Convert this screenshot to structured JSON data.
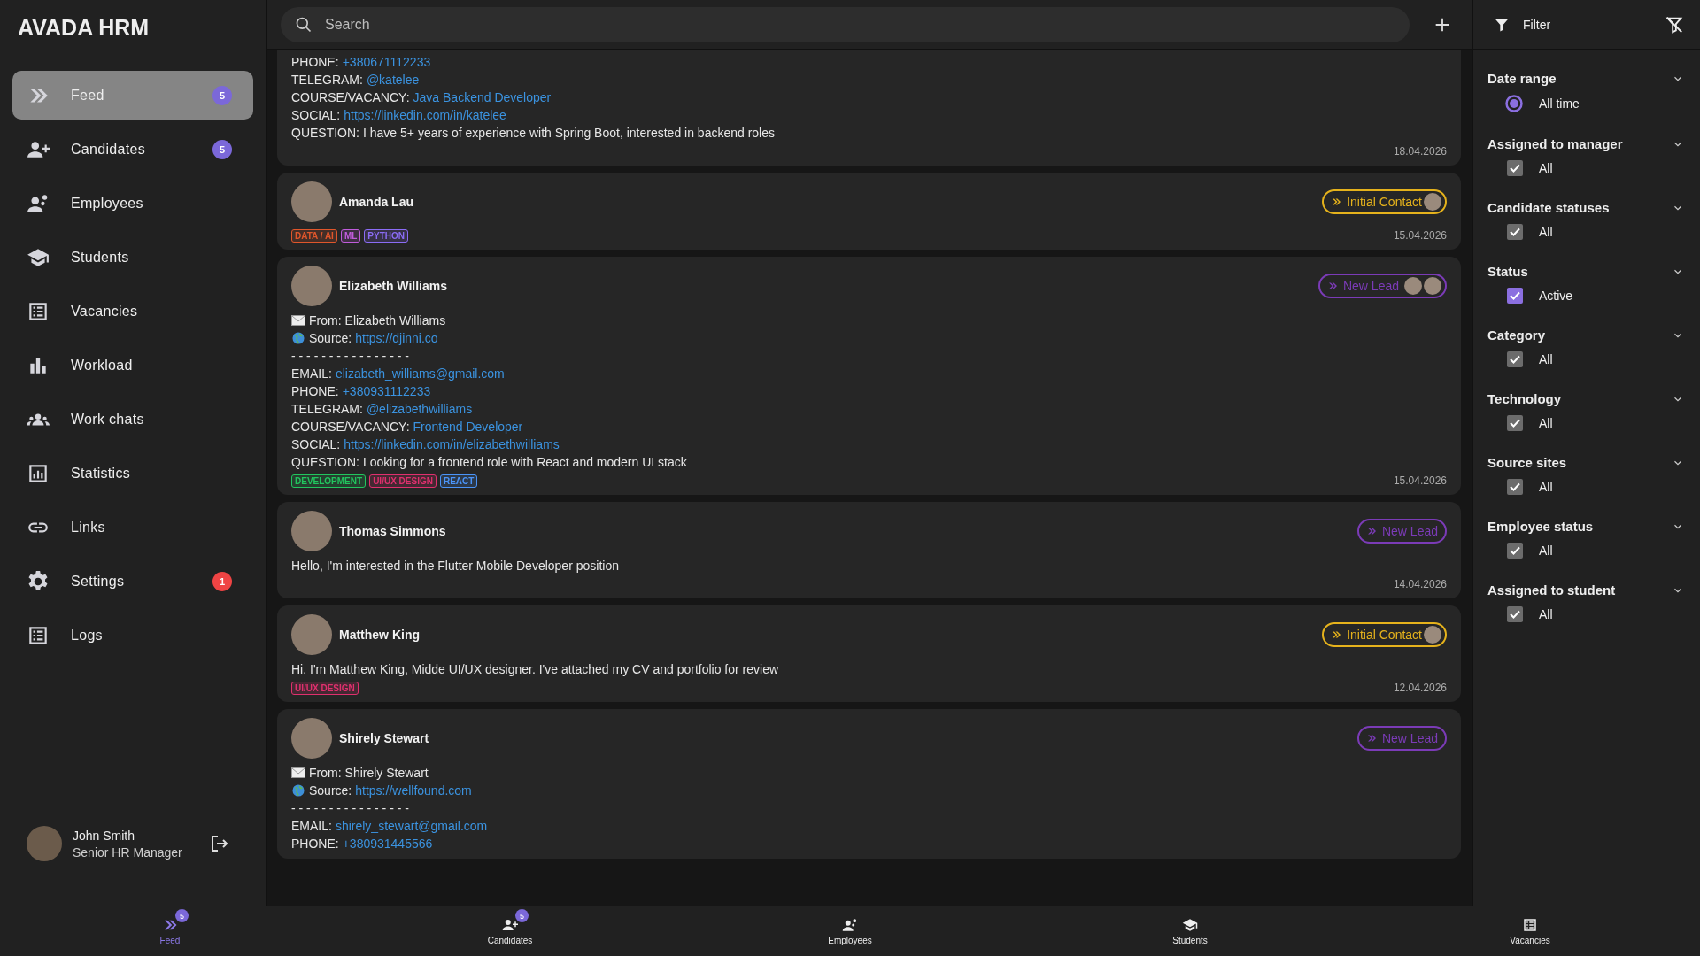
{
  "app": {
    "title": "AVADA HRM"
  },
  "sidebar": {
    "items": [
      {
        "label": "Feed",
        "badge": "5",
        "color": "#7b68d9",
        "selected": true
      },
      {
        "label": "Candidates",
        "badge": "5",
        "color": "#7b68d9",
        "selected": false
      },
      {
        "label": "Employees",
        "selected": false
      },
      {
        "label": "Students",
        "selected": false
      },
      {
        "label": "Vacancies",
        "selected": false
      },
      {
        "label": "Workload",
        "selected": false
      },
      {
        "label": "Work chats",
        "selected": false
      },
      {
        "label": "Statistics",
        "selected": false
      },
      {
        "label": "Links",
        "selected": false
      },
      {
        "label": "Settings",
        "badge": "1",
        "color": "#ef4444",
        "selected": false
      },
      {
        "label": "Logs",
        "selected": false
      }
    ],
    "user": {
      "name": "John Smith",
      "role": "Senior HR Manager"
    }
  },
  "search": {
    "placeholder": "Search"
  },
  "feed": [
    {
      "cut_top": true,
      "lines": [
        {
          "kind": "field",
          "label": "PHONE:",
          "value": "+380671112233",
          "link": true
        },
        {
          "kind": "field",
          "label": "TELEGRAM:",
          "value": "@katelee",
          "link": true
        },
        {
          "kind": "field",
          "label": "COURSE/VACANCY:",
          "value": "Java Backend Developer",
          "link": true
        },
        {
          "kind": "field",
          "label": "SOCIAL:",
          "value": "https://linkedin.com/in/katelee",
          "link": true
        },
        {
          "kind": "field",
          "label": "QUESTION:",
          "value": "I have 5+ years of experience with Spring Boot, interested in backend roles",
          "link": false
        }
      ],
      "date": "18.04.2026"
    },
    {
      "cut_top": false,
      "name": "Amanda Lau",
      "status": {
        "label": "Initial Contact",
        "kind": "initial",
        "assignees": [
          {
            "kind": "photo"
          }
        ]
      },
      "tags": [
        {
          "label": "DATA / AI",
          "color": "#e0562b"
        },
        {
          "label": "ML",
          "color": "#c05cdb"
        },
        {
          "label": "PYTHON",
          "color": "#8b6cf5"
        }
      ],
      "date": "15.04.2026"
    },
    {
      "cut_top": false,
      "name": "Elizabeth Williams",
      "status": {
        "label": "New Lead",
        "kind": "new",
        "assignees": [
          {
            "kind": "photo"
          },
          {
            "kind": "photo"
          }
        ]
      },
      "lines": [
        {
          "kind": "from",
          "label": "From:",
          "value": "Elizabeth Williams",
          "link": false
        },
        {
          "kind": "source",
          "label": "Source:",
          "value": "https://djinni.co",
          "link": true
        },
        {
          "kind": "separator",
          "value": "- - - - - - - - - - - - - - - -"
        },
        {
          "kind": "field",
          "label": "EMAIL:",
          "value": "elizabeth_williams@gmail.com",
          "link": true
        },
        {
          "kind": "field",
          "label": "PHONE:",
          "value": "+380931112233",
          "link": true
        },
        {
          "kind": "field",
          "label": "TELEGRAM:",
          "value": "@elizabethwilliams",
          "link": true
        },
        {
          "kind": "field",
          "label": "COURSE/VACANCY:",
          "value": "Frontend Developer",
          "link": true
        },
        {
          "kind": "field",
          "label": "SOCIAL:",
          "value": "https://linkedin.com/in/elizabethwilliams",
          "link": true
        },
        {
          "kind": "field",
          "label": "QUESTION:",
          "value": "Looking for a frontend role with React and modern UI stack",
          "link": false
        }
      ],
      "tags": [
        {
          "label": "DEVELOPMENT",
          "color": "#22c55e"
        },
        {
          "label": "UI/UX DESIGN",
          "color": "#e0306e"
        },
        {
          "label": "REACT",
          "color": "#4b94f8"
        }
      ],
      "date": "15.04.2026"
    },
    {
      "cut_top": false,
      "name": "Thomas Simmons",
      "status": {
        "label": "New Lead",
        "kind": "new"
      },
      "lines": [
        {
          "kind": "text",
          "value": "Hello, I'm interested in the Flutter Mobile Developer position"
        }
      ],
      "date": "14.04.2026"
    },
    {
      "cut_top": false,
      "name": "Matthew King",
      "status": {
        "label": "Initial Contact",
        "kind": "initial",
        "assignees": [
          {
            "kind": "photo"
          }
        ]
      },
      "lines": [
        {
          "kind": "text",
          "value": "Hi, I'm Matthew King, Midde UI/UX designer. I've attached my CV and portfolio for review"
        }
      ],
      "tags": [
        {
          "label": "UI/UX DESIGN",
          "color": "#e0306e"
        }
      ],
      "date": "12.04.2026"
    },
    {
      "cut_top": false,
      "name": "Shirely Stewart",
      "status": {
        "label": "New Lead",
        "kind": "new"
      },
      "lines": [
        {
          "kind": "from",
          "label": "From:",
          "value": "Shirely Stewart",
          "link": false
        },
        {
          "kind": "source",
          "label": "Source:",
          "value": "https://wellfound.com",
          "link": true
        },
        {
          "kind": "separator",
          "value": "- - - - - - - - - - - - - - - -"
        },
        {
          "kind": "field",
          "label": "EMAIL:",
          "value": "shirely_stewart@gmail.com",
          "link": true
        },
        {
          "kind": "field",
          "label": "PHONE:",
          "value": "+380931445566",
          "link": true
        }
      ]
    }
  ],
  "filter": {
    "title": "Filter",
    "sections": [
      {
        "title": "Date range",
        "kind": "radio",
        "option": "All time",
        "checked": true,
        "disabled": false
      },
      {
        "title": "Assigned to manager",
        "kind": "checkbox",
        "option": "All",
        "checked": true,
        "disabled": true
      },
      {
        "title": "Candidate statuses",
        "kind": "checkbox",
        "option": "All",
        "checked": true,
        "disabled": true
      },
      {
        "title": "Status",
        "kind": "checkbox",
        "option": "Active",
        "checked": true,
        "disabled": false
      },
      {
        "title": "Category",
        "kind": "checkbox",
        "option": "All",
        "checked": true,
        "disabled": true
      },
      {
        "title": "Technology",
        "kind": "checkbox",
        "option": "All",
        "checked": true,
        "disabled": true
      },
      {
        "title": "Source sites",
        "kind": "checkbox",
        "option": "All",
        "checked": true,
        "disabled": true
      },
      {
        "title": "Employee status",
        "kind": "checkbox",
        "option": "All",
        "checked": true,
        "disabled": true
      },
      {
        "title": "Assigned to student",
        "kind": "checkbox",
        "option": "All",
        "checked": true,
        "disabled": true
      }
    ]
  },
  "bottom_nav": [
    {
      "label": "Feed",
      "badge": "5",
      "selected": true
    },
    {
      "label": "Candidates",
      "badge": "5",
      "selected": false
    },
    {
      "label": "Employees",
      "selected": false
    },
    {
      "label": "Students",
      "selected": false
    },
    {
      "label": "Vacancies",
      "selected": false
    }
  ]
}
